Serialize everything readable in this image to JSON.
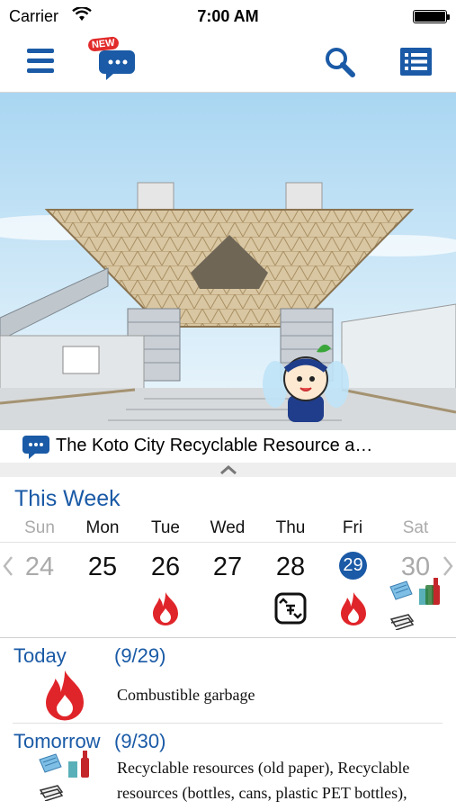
{
  "status_bar": {
    "carrier": "Carrier",
    "time": "7:00 AM"
  },
  "toolbar": {
    "new_badge": "NEW"
  },
  "news": {
    "headline": "The Koto City Recyclable Resource a…"
  },
  "week": {
    "title": "This Week",
    "days": [
      {
        "name": "Sun",
        "date": "24"
      },
      {
        "name": "Mon",
        "date": "25"
      },
      {
        "name": "Tue",
        "date": "26"
      },
      {
        "name": "Wed",
        "date": "27"
      },
      {
        "name": "Thu",
        "date": "28"
      },
      {
        "name": "Fri",
        "date": "29"
      },
      {
        "name": "Sat",
        "date": "30"
      }
    ]
  },
  "today": {
    "label": "Today",
    "date": "(9/29)",
    "desc": "Combustible garbage"
  },
  "tomorrow": {
    "label": "Tomorrow",
    "date": "(9/30)",
    "desc_line1": "Recyclable resources (old paper), Recyclable",
    "desc_line2": "resources (bottles, cans, plastic PET bottles),"
  },
  "colors": {
    "accent": "#1a5aa6",
    "fire": "#e0252a",
    "sky": "#cfe6f7"
  },
  "icons": [
    "menu-icon",
    "chat-icon",
    "search-icon",
    "list-icon",
    "fire-icon",
    "recycle-icon",
    "paper-icon",
    "bottles-icon",
    "cans-icon"
  ]
}
